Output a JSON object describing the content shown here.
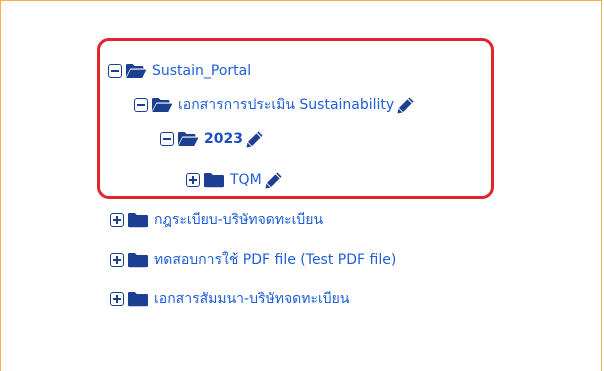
{
  "tree": {
    "root": {
      "label": "Sustain_Portal",
      "state": "expanded",
      "icon": "folder-open-icon"
    },
    "level1": {
      "label": "เอกสารการประเมิน Sustainability",
      "state": "expanded",
      "icon": "folder-open-icon",
      "editable": true
    },
    "level2": {
      "label": "2023",
      "state": "expanded",
      "icon": "folder-open-icon",
      "editable": true
    },
    "level3": {
      "label": "TQM",
      "state": "collapsed",
      "icon": "folder-icon",
      "editable": true
    },
    "others": [
      {
        "label": "กฎระเบียบ-บริษัทจดทะเบียน",
        "state": "collapsed",
        "icon": "folder-icon"
      },
      {
        "label": "ทดสอบการใช้ PDF file (Test PDF file)",
        "state": "collapsed",
        "icon": "folder-icon"
      },
      {
        "label": "เอกสารสัมมนา-บริษัทจดทะเบียน",
        "state": "collapsed",
        "icon": "folder-icon"
      }
    ]
  },
  "colors": {
    "border": "#f5b041",
    "highlight": "#e0262c",
    "icon": "#1d3f91",
    "link": "#1d5fd6"
  }
}
